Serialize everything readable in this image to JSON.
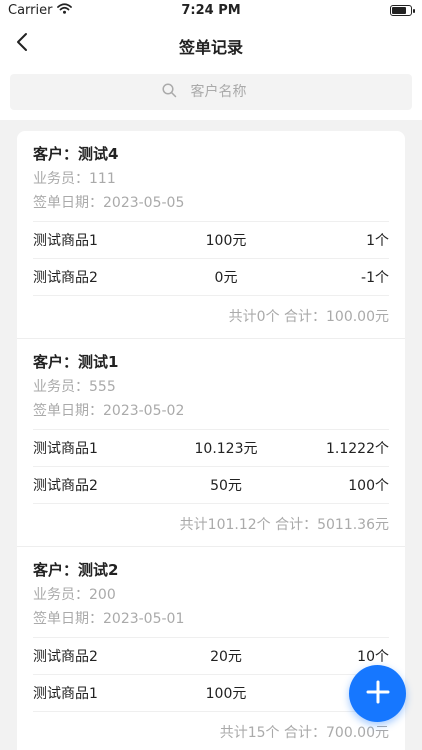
{
  "status_bar": {
    "carrier": "Carrier",
    "time": "7:24 PM",
    "battery_level": 0.8
  },
  "nav": {
    "title": "签单记录"
  },
  "search": {
    "placeholder": "客户名称"
  },
  "records": [
    {
      "customer": "客户：测试4",
      "salesperson": "业务员：111",
      "date": "签单日期：2023-05-05",
      "items": [
        {
          "name": "测试商品1",
          "price": "100元",
          "qty": "1个"
        },
        {
          "name": "测试商品2",
          "price": "0元",
          "qty": "-1个"
        }
      ],
      "summary": "共计0个 合计：100.00元"
    },
    {
      "customer": "客户：测试1",
      "salesperson": "业务员：555",
      "date": "签单日期：2023-05-02",
      "items": [
        {
          "name": "测试商品1",
          "price": "10.123元",
          "qty": "1.1222个"
        },
        {
          "name": "测试商品2",
          "price": "50元",
          "qty": "100个"
        }
      ],
      "summary": "共计101.12个 合计：5011.36元"
    },
    {
      "customer": "客户：测试2",
      "salesperson": "业务员：200",
      "date": "签单日期：2023-05-01",
      "items": [
        {
          "name": "测试商品2",
          "price": "20元",
          "qty": "10个"
        },
        {
          "name": "测试商品1",
          "price": "100元",
          "qty": ""
        }
      ],
      "summary": "共计15个 合计：700.00元"
    }
  ],
  "colors": {
    "accent": "#1677ff",
    "muted_text": "#aaaaaa",
    "background": "#f2f2f2"
  },
  "icons": {
    "back": "chevron-left-icon",
    "search": "search-icon",
    "add": "plus-icon",
    "wifi": "wifi-icon",
    "battery": "battery-icon"
  }
}
